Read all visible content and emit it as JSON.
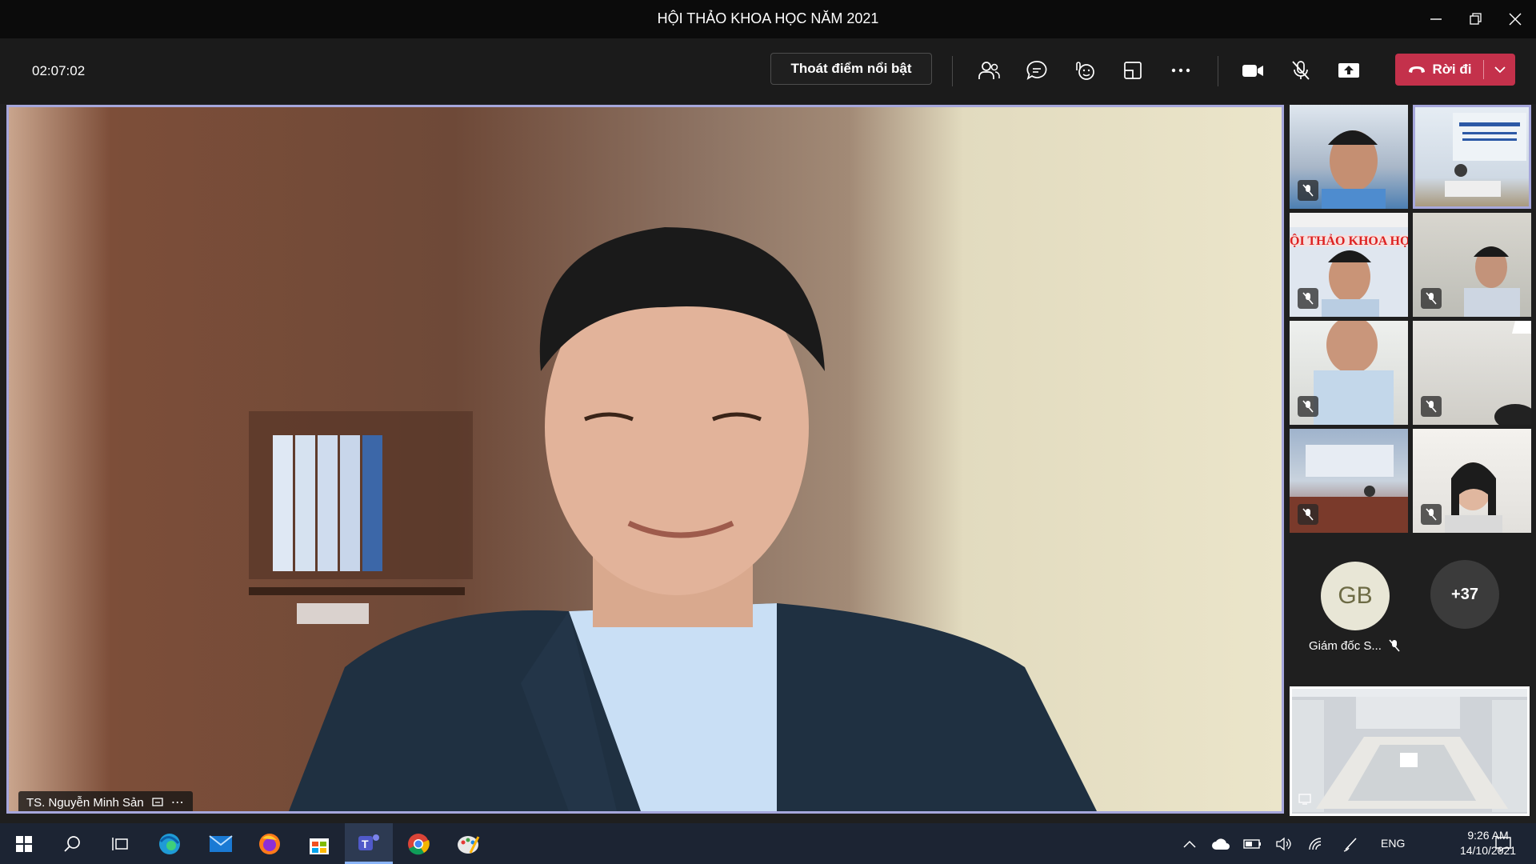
{
  "window": {
    "title": "HỘI THẢO KHOA HỌC NĂM 2021"
  },
  "toolbar": {
    "timer": "02:07:02",
    "exit_spotlight_label": "Thoát điểm nổi bật",
    "leave_label": "Rời đi"
  },
  "main_video": {
    "speaker_name": "TS. Nguyễn Minh Sản"
  },
  "participants": {
    "gb_initials": "GB",
    "gb_name": "Giám đốc S...",
    "overflow_count": "+37"
  },
  "taskbar": {
    "language": "ENG",
    "time": "9:26 AM",
    "date": "14/10/2021"
  },
  "colors": {
    "leave_button": "#c4314b",
    "spotlight_border": "#a6a7dc",
    "taskbar": "#1c2433"
  }
}
